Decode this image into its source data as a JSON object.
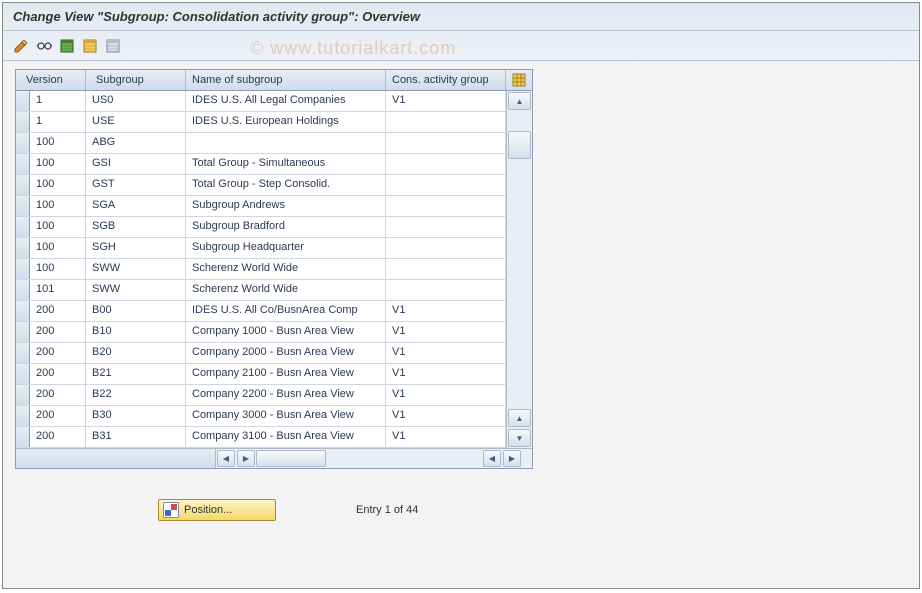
{
  "title": "Change View \"Subgroup: Consolidation activity group\": Overview",
  "watermark": "© www.tutorialkart.com",
  "toolbar": {
    "icons": [
      "pencil",
      "glasses",
      "table-green",
      "table-yellow",
      "table-gray"
    ]
  },
  "columns": {
    "version": "Version",
    "subgroup": "Subgroup",
    "name": "Name of subgroup",
    "cons": "Cons. activity group"
  },
  "rows": [
    {
      "version": "1",
      "subgroup": "US0",
      "name": "IDES U.S. All Legal Companies",
      "cons": "V1"
    },
    {
      "version": "1",
      "subgroup": "USE",
      "name": "IDES U.S. European Holdings",
      "cons": ""
    },
    {
      "version": "100",
      "subgroup": "ABG",
      "name": "",
      "cons": ""
    },
    {
      "version": "100",
      "subgroup": "GSI",
      "name": "Total Group - Simultaneous",
      "cons": ""
    },
    {
      "version": "100",
      "subgroup": "GST",
      "name": "Total Group - Step Consolid.",
      "cons": ""
    },
    {
      "version": "100",
      "subgroup": "SGA",
      "name": "Subgroup Andrews",
      "cons": ""
    },
    {
      "version": "100",
      "subgroup": "SGB",
      "name": "Subgroup Bradford",
      "cons": ""
    },
    {
      "version": "100",
      "subgroup": "SGH",
      "name": "Subgroup Headquarter",
      "cons": ""
    },
    {
      "version": "100",
      "subgroup": "SWW",
      "name": "Scherenz World Wide",
      "cons": ""
    },
    {
      "version": "101",
      "subgroup": "SWW",
      "name": "Scherenz World Wide",
      "cons": ""
    },
    {
      "version": "200",
      "subgroup": "B00",
      "name": "IDES U.S. All Co/BusnArea Comp",
      "cons": "V1"
    },
    {
      "version": "200",
      "subgroup": "B10",
      "name": "Company 1000 - Busn Area View",
      "cons": "V1"
    },
    {
      "version": "200",
      "subgroup": "B20",
      "name": "Company 2000 - Busn Area View",
      "cons": "V1"
    },
    {
      "version": "200",
      "subgroup": "B21",
      "name": "Company 2100 - Busn Area View",
      "cons": "V1"
    },
    {
      "version": "200",
      "subgroup": "B22",
      "name": "Company 2200 - Busn Area View",
      "cons": "V1"
    },
    {
      "version": "200",
      "subgroup": "B30",
      "name": "Company 3000 - Busn Area View",
      "cons": "V1"
    },
    {
      "version": "200",
      "subgroup": "B31",
      "name": "Company 3100 - Busn Area View",
      "cons": "V1"
    }
  ],
  "footer": {
    "position_label": "Position...",
    "entry_text": "Entry 1 of 44"
  }
}
